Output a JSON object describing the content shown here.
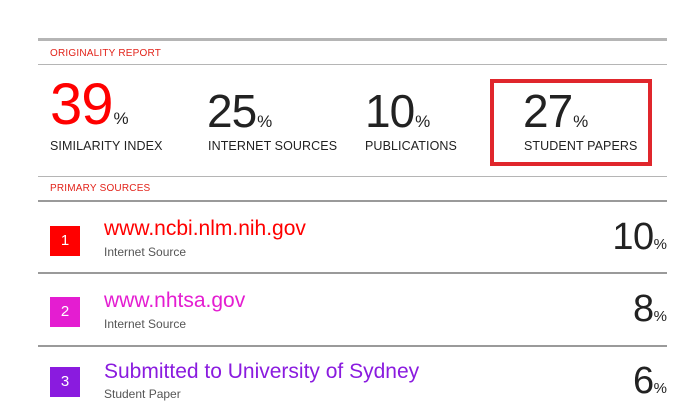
{
  "header": {
    "title": "ORIGINALITY REPORT"
  },
  "stats": [
    {
      "value": "39",
      "unit": "%",
      "label": "SIMILARITY INDEX"
    },
    {
      "value": "25",
      "unit": "%",
      "label": "INTERNET SOURCES"
    },
    {
      "value": "10",
      "unit": "%",
      "label": "PUBLICATIONS"
    },
    {
      "value": "27",
      "unit": "%",
      "label": "STUDENT PAPERS"
    }
  ],
  "primary_sources": {
    "title": "PRIMARY SOURCES",
    "items": [
      {
        "rank": "1",
        "name": "www.ncbi.nlm.nih.gov",
        "type": "Internet Source",
        "value": "10",
        "unit": "%",
        "color": "#ff0000"
      },
      {
        "rank": "2",
        "name": "www.nhtsa.gov",
        "type": "Internet Source",
        "value": "8",
        "unit": "%",
        "color": "#e41dd1"
      },
      {
        "rank": "3",
        "name": "Submitted to University of Sydney",
        "type": "Student Paper",
        "value": "6",
        "unit": "%",
        "color": "#8a1bdf"
      }
    ]
  },
  "colors": {
    "accent": "#e2231a",
    "highlight_box": "#e0262c",
    "similarity_value": "#ff0000"
  }
}
